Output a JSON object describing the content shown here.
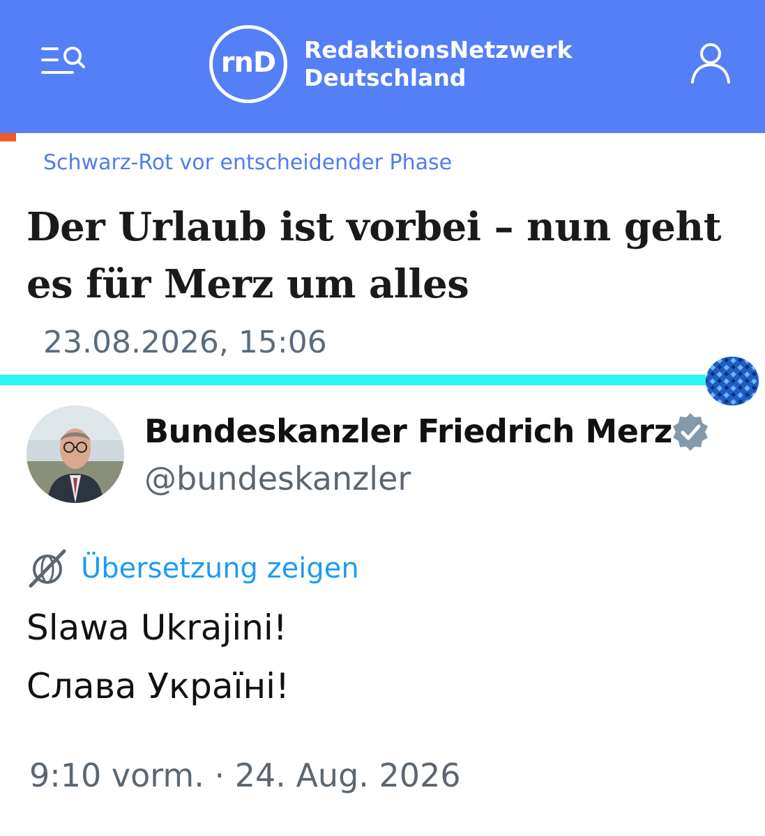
{
  "header": {
    "logo_text": "rnD",
    "brand_line1": "RedaktionsNetzwerk",
    "brand_line2": "Deutschland",
    "menu_icon": "menu-search-icon",
    "user_icon": "user-icon",
    "background_color": "#557ff7"
  },
  "article": {
    "kicker": "Schwarz-Rot vor entscheidender Phase",
    "headline_line1": "Der Urlaub ist vorbei – nun geht",
    "headline_line2": "es für Merz um alles",
    "date": "23.08.2026, 15:06"
  },
  "tweet": {
    "author_name": "Bundeskanzler Friedrich Merz",
    "handle": "@bundeskanzler",
    "verified_icon": "verified-badge-icon",
    "translate_label": "Übersetzung zeigen",
    "text_line1": "Slawa Ukrajini!",
    "text_line2": "Слава Україні!",
    "timestamp": "9:10 vorm. · 24. Aug. 2026"
  },
  "colors": {
    "accent_blue": "#557ff7",
    "link_blue": "#1d9bf0",
    "divider_cyan": "#2af6f6",
    "orange_mark": "#f0592a"
  }
}
